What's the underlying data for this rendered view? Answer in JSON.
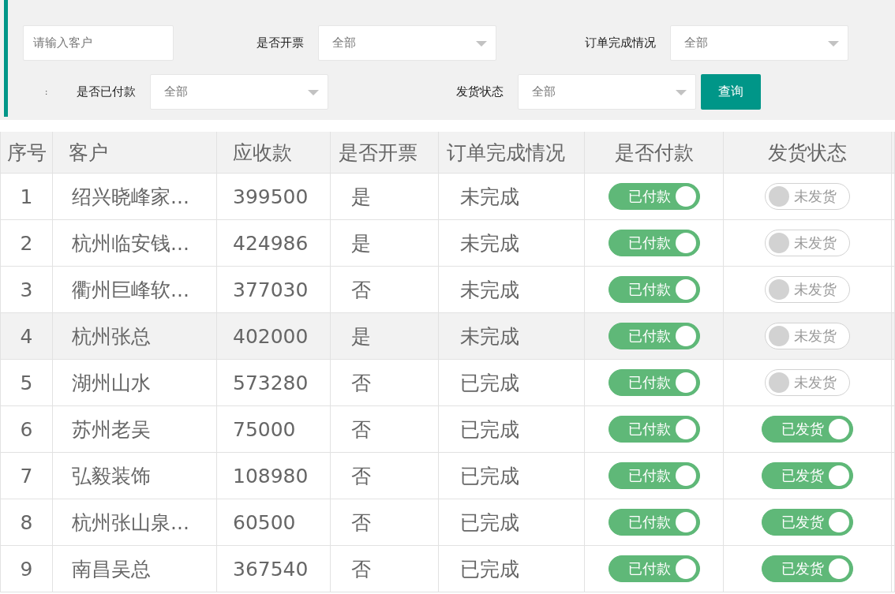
{
  "filters": {
    "customer": {
      "placeholder": "请输入客户"
    },
    "invoice": {
      "label": "是否开票",
      "value": "全部"
    },
    "completion": {
      "label": "订单完成情况",
      "value": "全部"
    },
    "colon": ":",
    "paid": {
      "label": "是否已付款",
      "value": "全部"
    },
    "shipping": {
      "label": "发货状态",
      "value": "全部"
    },
    "search_button": "查询"
  },
  "table": {
    "columns": [
      "序号",
      "客户",
      "应收款",
      "是否开票",
      "订单完成情况",
      "是否付款",
      "发货状态"
    ],
    "rows": [
      {
        "no": "1",
        "customer": "绍兴晓峰家...",
        "amount": "399500",
        "invoice": "是",
        "completion": "未完成",
        "paid": {
          "on": true,
          "label": "已付款"
        },
        "shipped": {
          "on": false,
          "label": "未发货"
        },
        "selected": false
      },
      {
        "no": "2",
        "customer": "杭州临安钱...",
        "amount": "424986",
        "invoice": "是",
        "completion": "未完成",
        "paid": {
          "on": true,
          "label": "已付款"
        },
        "shipped": {
          "on": false,
          "label": "未发货"
        },
        "selected": false
      },
      {
        "no": "3",
        "customer": "衢州巨峰软...",
        "amount": "377030",
        "invoice": "否",
        "completion": "未完成",
        "paid": {
          "on": true,
          "label": "已付款"
        },
        "shipped": {
          "on": false,
          "label": "未发货"
        },
        "selected": false
      },
      {
        "no": "4",
        "customer": "杭州张总",
        "amount": "402000",
        "invoice": "是",
        "completion": "未完成",
        "paid": {
          "on": true,
          "label": "已付款"
        },
        "shipped": {
          "on": false,
          "label": "未发货"
        },
        "selected": true
      },
      {
        "no": "5",
        "customer": "湖州山水",
        "amount": "573280",
        "invoice": "否",
        "completion": "已完成",
        "paid": {
          "on": true,
          "label": "已付款"
        },
        "shipped": {
          "on": false,
          "label": "未发货"
        },
        "selected": false
      },
      {
        "no": "6",
        "customer": "苏州老吴",
        "amount": "75000",
        "invoice": "否",
        "completion": "已完成",
        "paid": {
          "on": true,
          "label": "已付款"
        },
        "shipped": {
          "on": true,
          "label": "已发货"
        },
        "selected": false
      },
      {
        "no": "7",
        "customer": "弘毅装饰",
        "amount": "108980",
        "invoice": "否",
        "completion": "已完成",
        "paid": {
          "on": true,
          "label": "已付款"
        },
        "shipped": {
          "on": true,
          "label": "已发货"
        },
        "selected": false
      },
      {
        "no": "8",
        "customer": "杭州张山泉...",
        "amount": "60500",
        "invoice": "否",
        "completion": "已完成",
        "paid": {
          "on": true,
          "label": "已付款"
        },
        "shipped": {
          "on": true,
          "label": "已发货"
        },
        "selected": false
      },
      {
        "no": "9",
        "customer": "南昌吴总",
        "amount": "367540",
        "invoice": "否",
        "completion": "已完成",
        "paid": {
          "on": true,
          "label": "已付款"
        },
        "shipped": {
          "on": true,
          "label": "已发货"
        },
        "selected": false
      }
    ]
  }
}
